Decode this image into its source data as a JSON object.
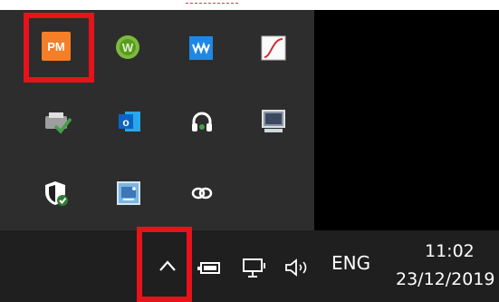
{
  "tray_overflow": {
    "icons": [
      {
        "name": "pm-icon",
        "label": "PM",
        "color": "#f47f28"
      },
      {
        "name": "w-app-icon",
        "label": "W",
        "color": "#7dbb3c"
      },
      {
        "name": "waves-icon",
        "label": "W",
        "color": "#1e88e5"
      },
      {
        "name": "curve-chart-icon",
        "label": ""
      },
      {
        "name": "printer-check-icon",
        "label": ""
      },
      {
        "name": "outlook-icon",
        "label": "o",
        "color": "#0a64c8"
      },
      {
        "name": "headset-icon",
        "label": ""
      },
      {
        "name": "monitor-icon",
        "label": ""
      },
      {
        "name": "shield-security-icon",
        "label": ""
      },
      {
        "name": "network-adapter-icon",
        "label": ""
      },
      {
        "name": "creative-cloud-icon",
        "label": ""
      }
    ]
  },
  "taskbar": {
    "chevron": "^",
    "language": "ENG",
    "time": "11:02",
    "date": "23/12/2019"
  },
  "colors": {
    "highlight": "#e8121a",
    "panel": "#2d2d2d",
    "taskbar": "#1f1f1f"
  }
}
